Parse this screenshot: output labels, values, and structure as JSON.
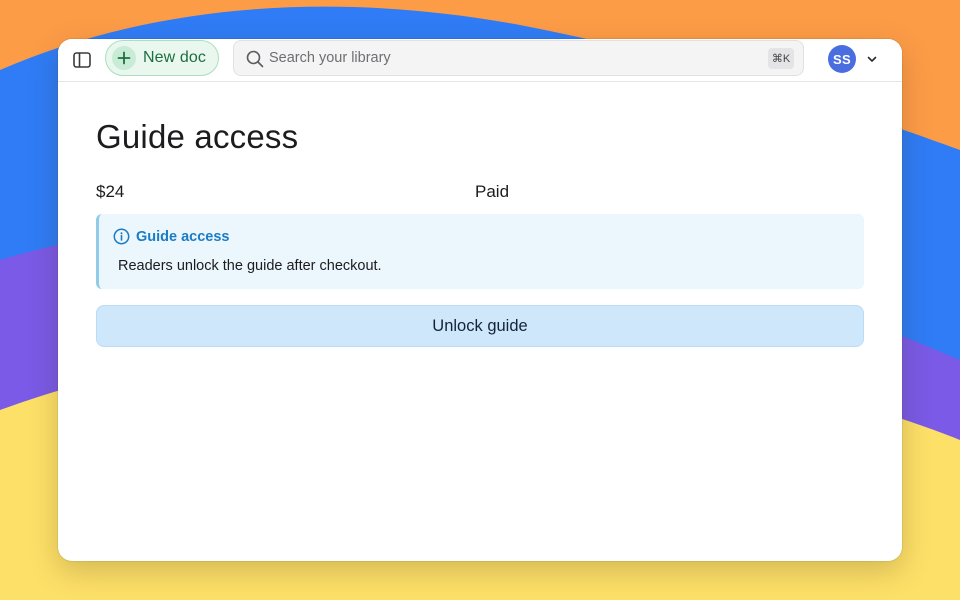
{
  "toolbar": {
    "new_doc_label": "New doc",
    "search_placeholder": "Search your library",
    "search_value": "",
    "search_shortcut": "⌘K",
    "avatar_initials": "SS"
  },
  "main": {
    "title": "Guide access",
    "price": "$24",
    "status": "Paid",
    "callout": {
      "title": "Guide access",
      "body": "Readers unlock the guide after checkout."
    },
    "unlock_label": "Unlock guide"
  },
  "colors": {
    "background_yellow": "#fde068",
    "background_orange": "#fd9c47",
    "background_blue": "#2f7cf6",
    "background_purple": "#7a5ae6",
    "new_doc_green": "#1e6e3f",
    "avatar_blue": "#4a6ee0",
    "callout_blue": "#1b7cc4",
    "unlock_button_bg": "#cfe7fb"
  },
  "icons": {
    "sidebar_toggle": "sidebar-toggle-icon",
    "new_doc": "plus-icon",
    "search": "search-icon",
    "account_menu": "chevron-down-icon",
    "callout": "info-icon"
  }
}
